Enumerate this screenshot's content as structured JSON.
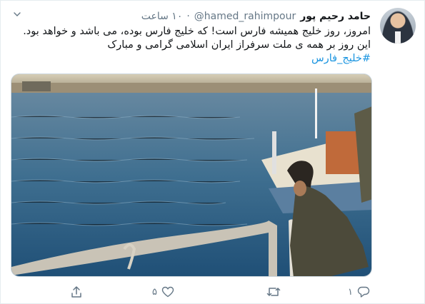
{
  "tweet": {
    "author_name": "حامد رحیم پور",
    "handle": "@hamed_rahimpour",
    "separator": "·",
    "time": "۱۰ ساعت",
    "lines": [
      "امروز، روز خلیج همیشه فارس است! که خلیج فارس بوده، می باشد و خواهد بود.",
      "این روز بر همه ی  ملت سرفراز ایران اسلامی گرامی و مبارک"
    ],
    "hashtag": "#خلیج_فارس"
  },
  "actions": {
    "reply_count": "۱",
    "retweet_count": "",
    "like_count": "۵"
  },
  "icons": {
    "more": "chevron-down-icon",
    "reply": "reply-icon",
    "retweet": "retweet-icon",
    "like": "heart-icon",
    "share": "share-icon"
  },
  "colors": {
    "link": "#1b95e0",
    "muted": "#657786"
  }
}
